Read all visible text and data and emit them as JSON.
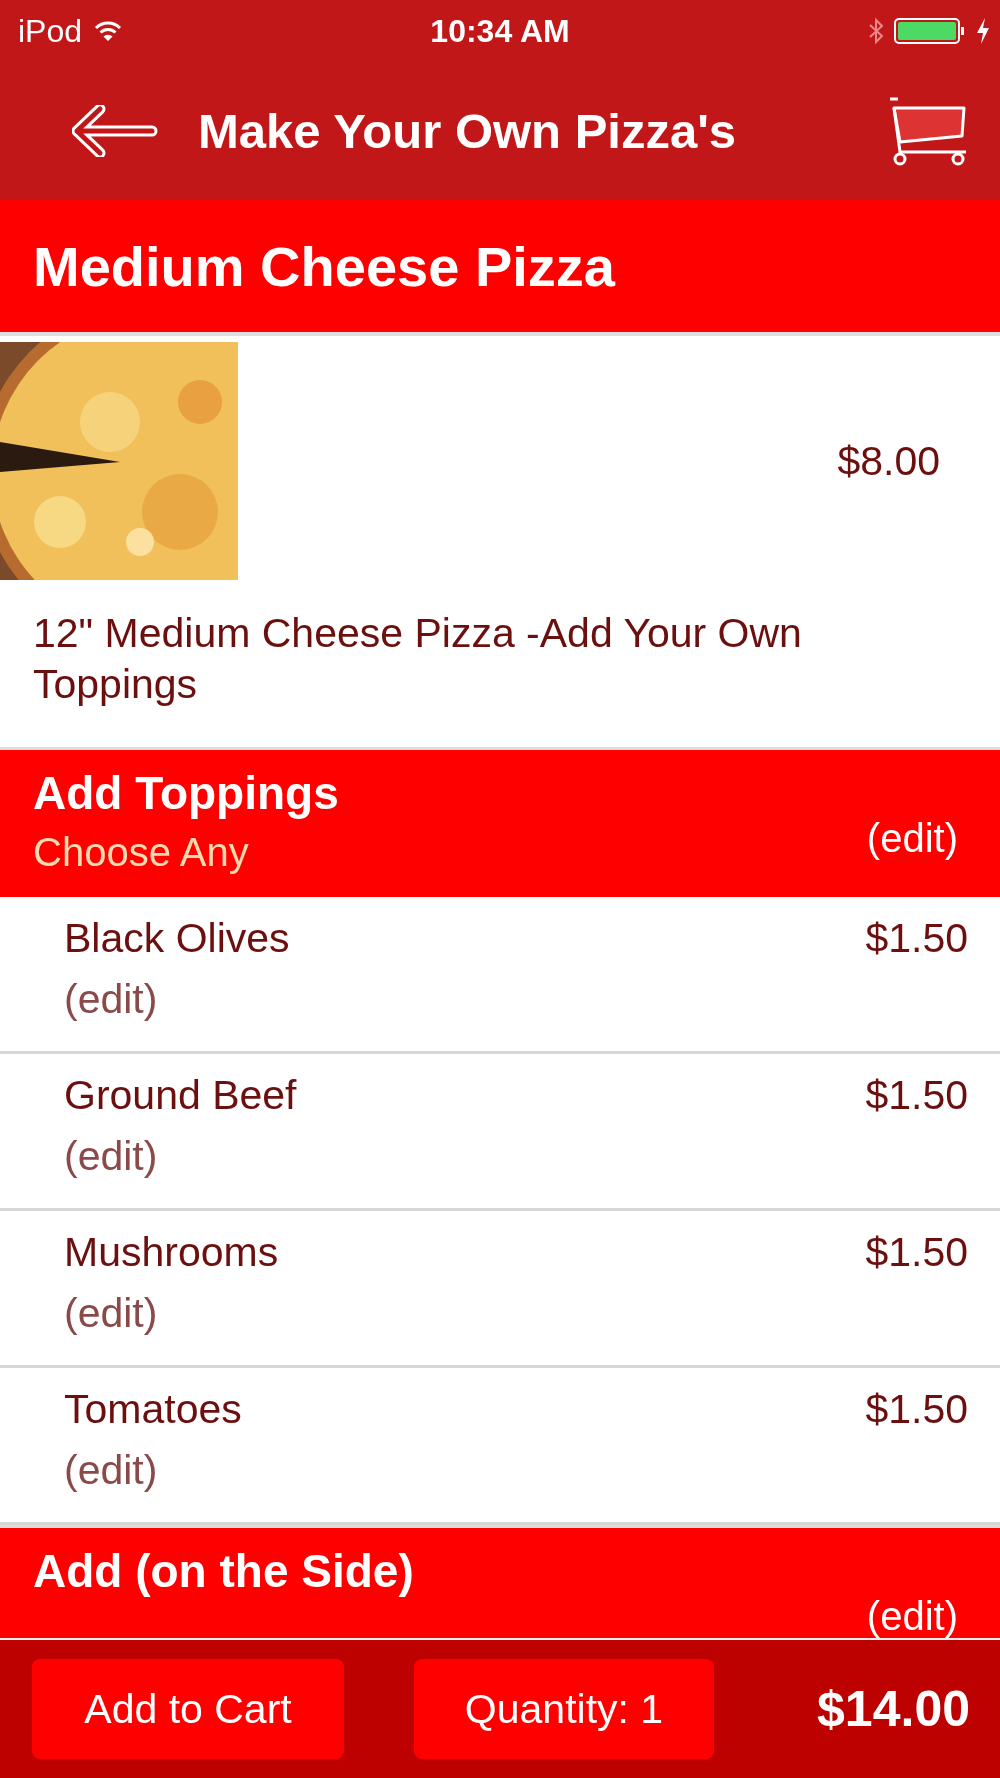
{
  "status_bar": {
    "carrier": "iPod",
    "time": "10:34 AM"
  },
  "nav": {
    "title": "Make Your Own Pizza's"
  },
  "product": {
    "title": "Medium Cheese Pizza",
    "price": "$8.00",
    "description": "12\" Medium Cheese Pizza -Add Your Own Toppings"
  },
  "sections": [
    {
      "title": "Add Toppings",
      "subtitle": "Choose Any",
      "edit": "(edit)",
      "items": [
        {
          "name": "Black Olives",
          "price": "$1.50",
          "edit": "(edit)"
        },
        {
          "name": "Ground Beef",
          "price": "$1.50",
          "edit": "(edit)"
        },
        {
          "name": "Mushrooms",
          "price": "$1.50",
          "edit": "(edit)"
        },
        {
          "name": "Tomatoes",
          "price": "$1.50",
          "edit": "(edit)"
        }
      ]
    },
    {
      "title": "Add (on the Side)",
      "edit": "(edit)"
    }
  ],
  "bottom_bar": {
    "add_button": "Add to Cart",
    "quantity_button": "Quantity: 1",
    "total": "$14.00"
  }
}
